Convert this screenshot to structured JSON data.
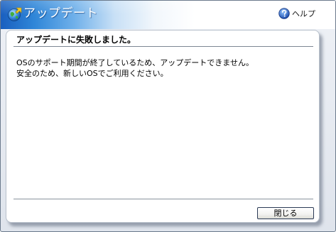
{
  "window": {
    "title": "アップデート",
    "app_icon": "globe-update-icon"
  },
  "header": {
    "help_label": "ヘルプ",
    "help_icon": "help-question-icon"
  },
  "dialog": {
    "error_title": "アップデートに失敗しました。",
    "message_lines": [
      "OSのサポート期間が終了しているため、アップデートできません。",
      "安全のため、新しいOSでご利用ください。"
    ],
    "close_label": "閉じる"
  },
  "colors": {
    "header_blue": "#1a5fbf",
    "panel_bg": "#ffffff",
    "window_bg": "#dfe4ec",
    "button_border": "#2b3a55"
  }
}
